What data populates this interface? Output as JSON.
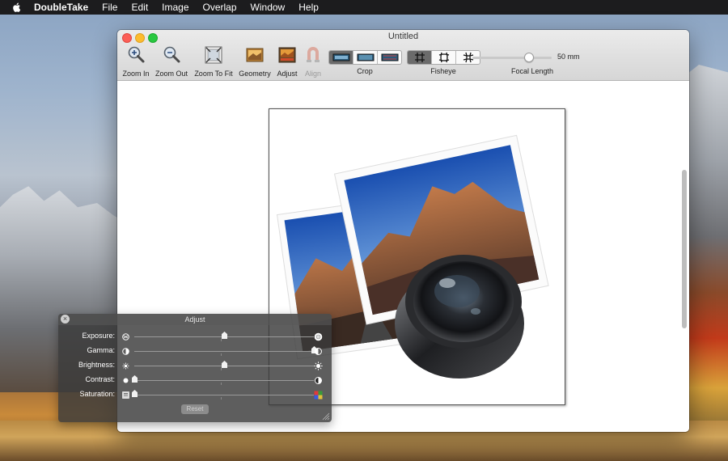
{
  "menubar": {
    "app_name": "DoubleTake",
    "items": [
      "File",
      "Edit",
      "Image",
      "Overlap",
      "Window",
      "Help"
    ]
  },
  "window": {
    "title": "Untitled"
  },
  "toolbar": {
    "zoom_in": "Zoom In",
    "zoom_out": "Zoom Out",
    "zoom_to_fit": "Zoom To Fit",
    "geometry": "Geometry",
    "adjust": "Adjust",
    "align": "Align",
    "crop_label": "Crop",
    "fisheye_label": "Fisheye",
    "focal_length_label": "Focal Length",
    "focal_length_value": "50 mm"
  },
  "adjust_panel": {
    "title": "Adjust",
    "reset": "Reset",
    "sliders": [
      {
        "label": "Exposure:",
        "value": 0.5
      },
      {
        "label": "Gamma:",
        "value": 1.0
      },
      {
        "label": "Brightness:",
        "value": 0.5
      },
      {
        "label": "Contrast:",
        "value": 0.0
      },
      {
        "label": "Saturation:",
        "value": 0.0
      }
    ]
  },
  "colors": {
    "menubar_bg": "#1c1c1e",
    "hud_bg": "#3a3a3a",
    "segment_selected": "#6b6b6b"
  }
}
